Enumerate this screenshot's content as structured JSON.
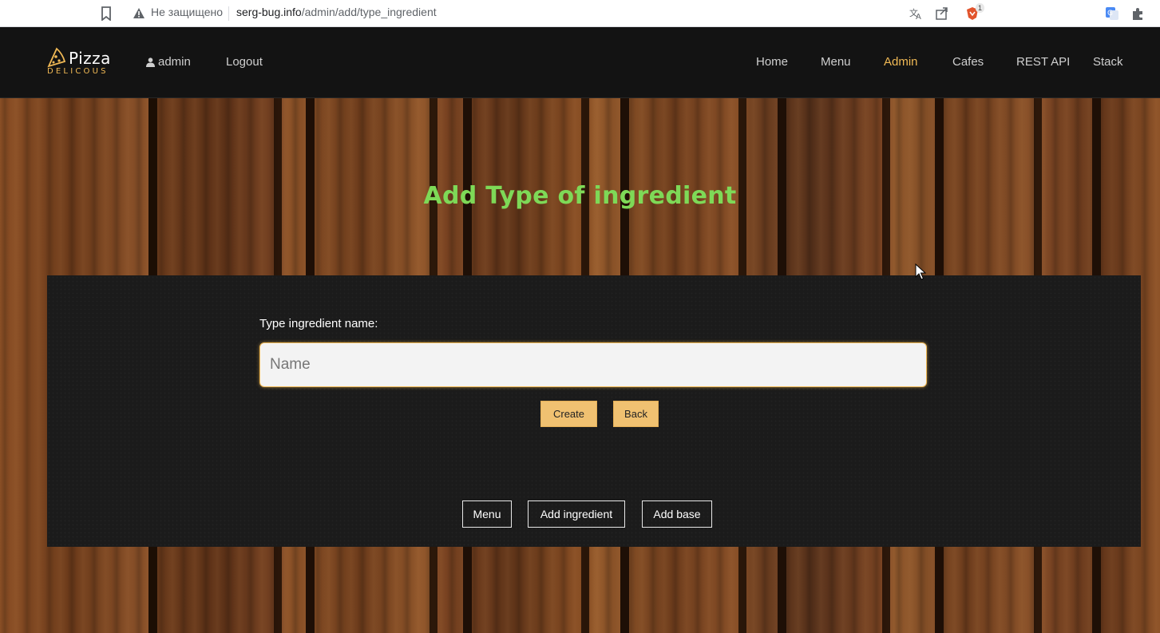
{
  "browser": {
    "security_label": "Не защищено",
    "url_host": "serg-bug.info",
    "url_path": "/admin/add/type_ingredient",
    "shield_count": "1",
    "icons": [
      "bookmark-icon",
      "warning-icon",
      "translate-icon",
      "share-icon",
      "brave-shield-icon",
      "google-translate-icon",
      "extensions-icon"
    ]
  },
  "header": {
    "logo_title": "Pizza",
    "logo_subtitle": "DELICOUS",
    "user_label": "admin",
    "logout_label": "Logout",
    "nav": [
      {
        "label": "Home",
        "active": false
      },
      {
        "label": "Menu",
        "active": false
      },
      {
        "label": "Admin",
        "active": true
      },
      {
        "label": "Cafes",
        "active": false
      },
      {
        "label": "REST API",
        "active": false
      },
      {
        "label": "Stack",
        "active": false
      }
    ]
  },
  "page": {
    "title": "Add Type of ingredient"
  },
  "form": {
    "field_label": "Type ingredient name:",
    "name_placeholder": "Name",
    "name_value": "",
    "create_label": "Create",
    "back_label": "Back"
  },
  "footer_links": {
    "menu_label": "Menu",
    "add_ingredient_label": "Add ingredient",
    "add_base_label": "Add base"
  },
  "colors": {
    "accent": "#f0b955",
    "title_green": "#7ed957",
    "header_bg": "#131313",
    "panel_bg": "#1b1b1b"
  }
}
